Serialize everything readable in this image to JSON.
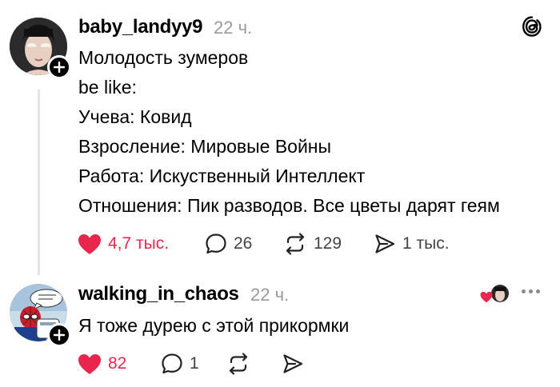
{
  "post": {
    "username": "baby_landyy9",
    "time": "22 ч.",
    "lines": [
      "Молодость зумеров",
      "be like:",
      "Учева: Ковид",
      "Взросление: Мировые Войны",
      "Работа: Искуственный Интеллект",
      "Отношения: Пик разводов. Все цветы дарят геям"
    ],
    "likes": "4,7 тыс.",
    "comments": "26",
    "reposts": "129",
    "shares": "1 тыс.",
    "avatar_icon": "person-avatar",
    "brand_icon": "threads-logo-icon"
  },
  "reply": {
    "username": "walking_in_chaos",
    "time": "22 ч.",
    "text": "Я тоже дурею с этой прикормки",
    "likes": "82",
    "comments": "1",
    "avatar_icon": "comic-spiderman-avatar"
  },
  "colors": {
    "like": "#e8264d",
    "muted": "#9a9a9a",
    "thread_line": "#e3e3e3"
  }
}
